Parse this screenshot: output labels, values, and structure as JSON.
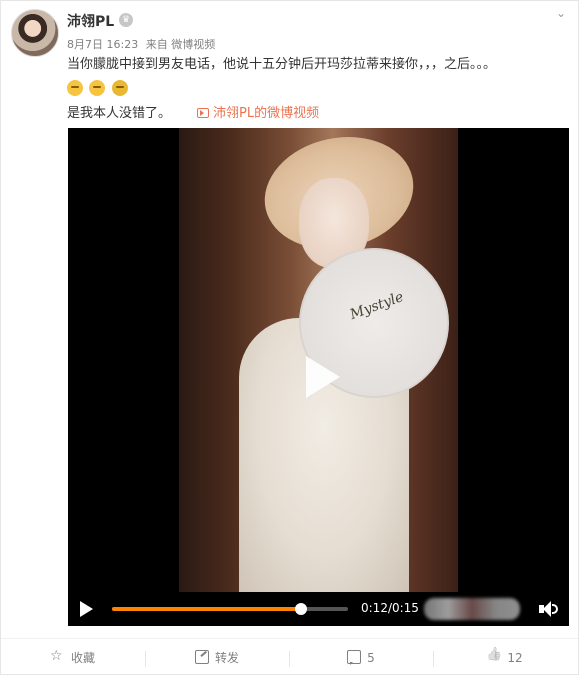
{
  "post": {
    "username": "沛翎PL",
    "vip_badge": "♛",
    "time": "8月7日 16:23",
    "source": "来自 微博视频",
    "text1": "当你朦胧中接到男友电话，他说十五分钟后开玛莎拉蒂来接你，，，之后。。。",
    "emojis": [
      "hug-emoji",
      "hug-emoji",
      "doll-emoji"
    ],
    "text2": "是我本人没错了。",
    "video_link": "沛翎PL的微博视频"
  },
  "video": {
    "watermark": "Mystyle",
    "current_time": "0:12",
    "duration": "0:15",
    "time_display": "0:12/0:15",
    "progress_fraction": 0.8,
    "accent_color": "#ff8200"
  },
  "actions": {
    "favorite": "收藏",
    "repost": "转发",
    "comment": "5",
    "like": "12"
  }
}
